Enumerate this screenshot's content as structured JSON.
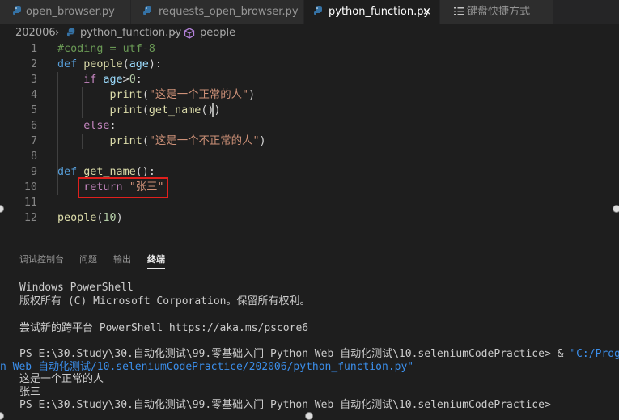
{
  "tabs": [
    {
      "label": "open_browser.py",
      "icon": "python-file-icon",
      "active": false
    },
    {
      "label": "requests_open_browser.py",
      "icon": "python-file-icon",
      "active": false
    },
    {
      "label": "python_function.py",
      "icon": "python-file-icon",
      "active": true,
      "close": "×"
    },
    {
      "label": "键盘快捷方式",
      "icon": "keyboard-shortcuts-icon",
      "active": false
    }
  ],
  "breadcrumb": {
    "folder": "202006",
    "sep": "›",
    "file": "python_function.py",
    "symbol": "people",
    "symbol_icon": "cube-symbol-icon"
  },
  "code_lines": [
    {
      "n": "1",
      "parts": [
        [
          "cm",
          "#coding = utf-8"
        ]
      ]
    },
    {
      "n": "2",
      "parts": [
        [
          "k1",
          "def "
        ],
        [
          "fn",
          "people"
        ],
        [
          "pl",
          "("
        ],
        [
          "pm",
          "age"
        ],
        [
          "pl",
          "):"
        ]
      ]
    },
    {
      "n": "3",
      "parts": [
        [
          "pl",
          "    "
        ],
        [
          "k2",
          "if "
        ],
        [
          "pm",
          "age"
        ],
        [
          "pl",
          ">"
        ],
        [
          "num",
          "0"
        ],
        [
          "pl",
          ":"
        ]
      ]
    },
    {
      "n": "4",
      "parts": [
        [
          "pl",
          "        "
        ],
        [
          "fn",
          "print"
        ],
        [
          "pl",
          "("
        ],
        [
          "str",
          "\"这是一个正常的人\""
        ],
        [
          "pl",
          ")"
        ]
      ]
    },
    {
      "n": "5",
      "parts": [
        [
          "pl",
          "        "
        ],
        [
          "fn",
          "print"
        ],
        [
          "pl",
          "("
        ],
        [
          "fn",
          "get_name"
        ],
        [
          "pl",
          "())"
        ]
      ]
    },
    {
      "n": "6",
      "parts": [
        [
          "pl",
          "    "
        ],
        [
          "k2",
          "else"
        ],
        [
          "pl",
          ":"
        ]
      ]
    },
    {
      "n": "7",
      "parts": [
        [
          "pl",
          "        "
        ],
        [
          "fn",
          "print"
        ],
        [
          "pl",
          "("
        ],
        [
          "str",
          "\"这是一个不正常的人\""
        ],
        [
          "pl",
          ")"
        ]
      ]
    },
    {
      "n": "8",
      "parts": []
    },
    {
      "n": "9",
      "parts": [
        [
          "k1",
          "def "
        ],
        [
          "fn",
          "get_name"
        ],
        [
          "pl",
          "():"
        ]
      ]
    },
    {
      "n": "10",
      "parts": [
        [
          "pl",
          "    "
        ],
        [
          "k2",
          "return "
        ],
        [
          "str",
          "\"张三\""
        ]
      ]
    },
    {
      "n": "11",
      "parts": []
    },
    {
      "n": "12",
      "parts": [
        [
          "fn",
          "people"
        ],
        [
          "pl",
          "("
        ],
        [
          "num",
          "10"
        ],
        [
          "pl",
          ")"
        ]
      ]
    }
  ],
  "panel_tabs": [
    {
      "label": "调试控制台",
      "active": false
    },
    {
      "label": "问题",
      "active": false
    },
    {
      "label": "输出",
      "active": false
    },
    {
      "label": "终端",
      "active": true
    }
  ],
  "terminal": {
    "l1": "Windows PowerShell",
    "l2": "版权所有 (C) Microsoft Corporation。保留所有权利。",
    "l3": "尝试新的跨平台 PowerShell https://aka.ms/pscore6",
    "l4": "PS E:\\30.Study\\30.自动化测试\\99.零基础入门 Python Web 自动化测试\\10.seleniumCodePractice> & ",
    "l4_link": "\"C:/Program",
    "l5": "n Web 自动化测试/10.seleniumCodePractice/202006/python_function.py\"",
    "l6": "这是一个正常的人",
    "l7": "张三",
    "l8": "PS E:\\30.Study\\30.自动化测试\\99.零基础入门 Python Web 自动化测试\\10.seleniumCodePractice>"
  },
  "colors": {
    "highlight_box": "#e0201d",
    "keyword": "#569cd6",
    "control": "#c586c0",
    "function": "#dcdcaa",
    "string": "#ce9178",
    "comment": "#6a9955"
  }
}
